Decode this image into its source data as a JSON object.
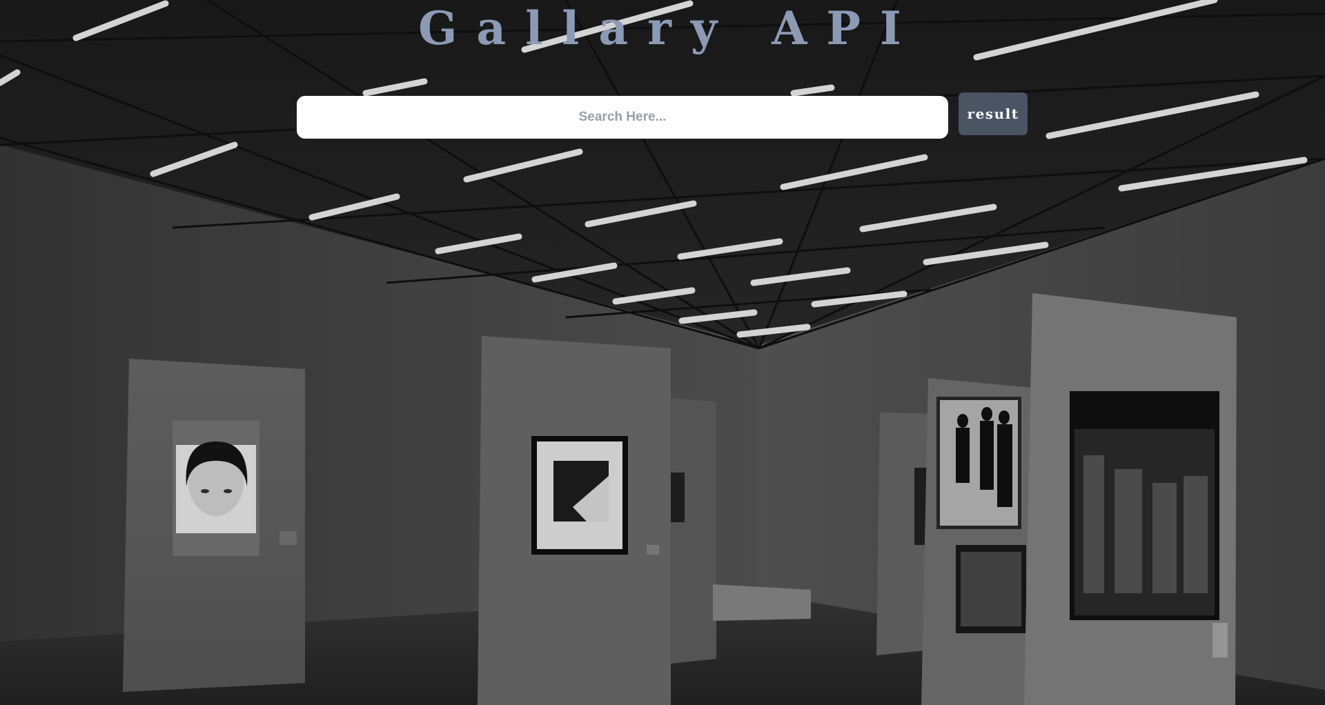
{
  "header": {
    "title": "Gallary API"
  },
  "search": {
    "placeholder": "Search Here...",
    "value": "",
    "button_label": "result"
  },
  "background": {
    "image_subject": "gallery-interior-photo",
    "tone": "grayscale"
  }
}
